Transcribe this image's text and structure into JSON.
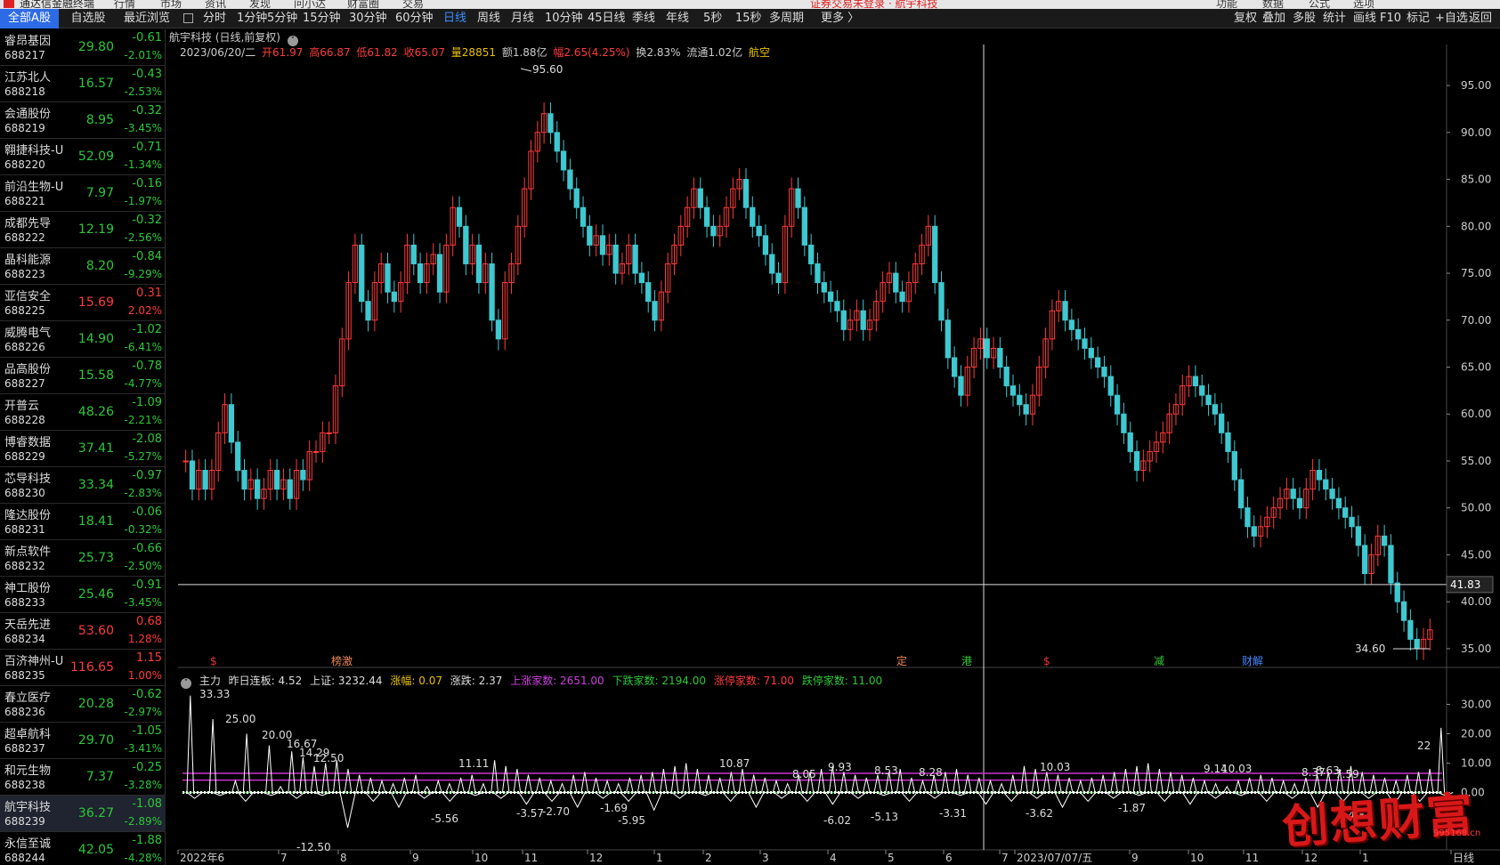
{
  "titlebar": {
    "app_title": "通达信金融终端",
    "menus": [
      "行情",
      "市场",
      "资讯",
      "发现",
      "问小达",
      "财富圈",
      "交易"
    ],
    "notice": "证券交易未登录 · 航宇科技",
    "right_menus": [
      "功能",
      "数据",
      "公式",
      "选项"
    ]
  },
  "toolbar": {
    "left_tabs": [
      "全部A股",
      "自选股",
      "最近浏览"
    ],
    "periods": [
      "分时",
      "1分钟",
      "5分钟",
      "15分钟",
      "30分钟",
      "60分钟",
      "日线",
      "周线",
      "月线",
      "10分钟",
      "45日线",
      "季线",
      "年线",
      "5秒",
      "15秒",
      "多周期",
      "更多 〉"
    ],
    "active_period": "日线",
    "right_buttons": [
      "复权",
      "叠加",
      "多股",
      "统计",
      "画线",
      "F10",
      "标记",
      "+自选",
      "返回"
    ]
  },
  "stocks": [
    {
      "name": "睿昂基因",
      "code": "688217",
      "price": "29.80",
      "change": "-0.61",
      "pct": "-2.01%",
      "dir": "dn"
    },
    {
      "name": "江苏北人",
      "code": "688218",
      "price": "16.57",
      "change": "-0.43",
      "pct": "-2.53%",
      "dir": "dn"
    },
    {
      "name": "会通股份",
      "code": "688219",
      "price": "8.95",
      "change": "-0.32",
      "pct": "-3.45%",
      "dir": "dn"
    },
    {
      "name": "翱捷科技-U",
      "code": "688220",
      "price": "52.09",
      "change": "-0.71",
      "pct": "-1.34%",
      "dir": "dn"
    },
    {
      "name": "前沿生物-U",
      "code": "688221",
      "price": "7.97",
      "change": "-0.16",
      "pct": "-1.97%",
      "dir": "dn"
    },
    {
      "name": "成都先导",
      "code": "688222",
      "price": "12.19",
      "change": "-0.32",
      "pct": "-2.56%",
      "dir": "dn"
    },
    {
      "name": "晶科能源",
      "code": "688223",
      "price": "8.20",
      "change": "-0.84",
      "pct": "-9.29%",
      "dir": "dn"
    },
    {
      "name": "亚信安全",
      "code": "688225",
      "price": "15.69",
      "change": "0.31",
      "pct": "2.02%",
      "dir": "up"
    },
    {
      "name": "威腾电气",
      "code": "688226",
      "price": "14.90",
      "change": "-1.02",
      "pct": "-6.41%",
      "dir": "dn"
    },
    {
      "name": "品高股份",
      "code": "688227",
      "price": "15.58",
      "change": "-0.78",
      "pct": "-4.77%",
      "dir": "dn"
    },
    {
      "name": "开普云",
      "code": "688228",
      "price": "48.26",
      "change": "-1.09",
      "pct": "-2.21%",
      "dir": "dn"
    },
    {
      "name": "博睿数据",
      "code": "688229",
      "price": "37.41",
      "change": "-2.08",
      "pct": "-5.27%",
      "dir": "dn"
    },
    {
      "name": "芯导科技",
      "code": "688230",
      "price": "33.34",
      "change": "-0.97",
      "pct": "-2.83%",
      "dir": "dn"
    },
    {
      "name": "隆达股份",
      "code": "688231",
      "price": "18.41",
      "change": "-0.06",
      "pct": "-0.32%",
      "dir": "dn"
    },
    {
      "name": "新点软件",
      "code": "688232",
      "price": "25.73",
      "change": "-0.66",
      "pct": "-2.50%",
      "dir": "dn"
    },
    {
      "name": "神工股份",
      "code": "688233",
      "price": "25.46",
      "change": "-0.91",
      "pct": "-3.45%",
      "dir": "dn"
    },
    {
      "name": "天岳先进",
      "code": "688234",
      "price": "53.60",
      "change": "0.68",
      "pct": "1.28%",
      "dir": "up"
    },
    {
      "name": "百济神州-U",
      "code": "688235",
      "price": "116.65",
      "change": "1.15",
      "pct": "1.00%",
      "dir": "up"
    },
    {
      "name": "春立医疗",
      "code": "688236",
      "price": "20.28",
      "change": "-0.62",
      "pct": "-2.97%",
      "dir": "dn"
    },
    {
      "name": "超卓航科",
      "code": "688237",
      "price": "29.70",
      "change": "-1.05",
      "pct": "-3.41%",
      "dir": "dn"
    },
    {
      "name": "和元生物",
      "code": "688238",
      "price": "7.37",
      "change": "-0.25",
      "pct": "-3.28%",
      "dir": "dn"
    },
    {
      "name": "航宇科技",
      "code": "688239",
      "price": "36.27",
      "change": "-1.08",
      "pct": "-2.89%",
      "dir": "dn",
      "selected": true
    },
    {
      "name": "永信至诚",
      "code": "688244",
      "price": "42.05",
      "change": "-1.88",
      "pct": "-4.28%",
      "dir": "dn"
    }
  ],
  "chart_header": {
    "title": "航宇科技 (日线,前复权)",
    "date": "2023/06/20/二",
    "open": "开61.97",
    "high": "高66.87",
    "low": "低61.82",
    "close": "收65.07",
    "volume": "量28851",
    "amount": "额1.88亿",
    "amplitude": "幅2.65(4.25%)",
    "turnover": "换2.83%",
    "float": "流通1.02亿",
    "sector": "航空"
  },
  "indicator_header": {
    "name": "主力",
    "prev_boards": "昨日连板: 4.52",
    "sh_index": "上证: 3232.44",
    "rise": "涨幅: 0.07",
    "fall": "涨跌: 2.37",
    "up_count": "上涨家数: 2651.00",
    "down_count": "下跌家数: 2194.00",
    "limit_up": "涨停家数: 71.00",
    "limit_down": "跌停家数: 11.00"
  },
  "chart_data": [
    {
      "type": "candlestick",
      "title": "航宇科技 (日线,前复权)",
      "y_ticks": [
        "95.00",
        "90.00",
        "85.00",
        "80.00",
        "75.00",
        "70.00",
        "65.00",
        "60.00",
        "55.00",
        "50.00",
        "45.00",
        "40.00",
        "35.00"
      ],
      "ylim": [
        33,
        97
      ],
      "cursor_price": "41.83",
      "high_label": "95.60",
      "low_label": "34.60",
      "x_ticks": [
        "2022年6",
        "7",
        "8",
        "9",
        "10",
        "11",
        "12",
        "1",
        "2",
        "3",
        "4",
        "5",
        "6",
        "7",
        "2023/07/07/五",
        "9",
        "10",
        "11",
        "12",
        "1",
        "日线"
      ],
      "close_path": [
        55,
        52,
        54,
        52,
        54,
        58,
        61,
        57,
        54,
        52,
        53,
        51,
        52,
        54,
        52,
        53,
        51,
        54,
        53,
        56,
        56,
        58,
        58,
        63,
        68,
        74,
        78,
        72,
        70,
        74,
        76,
        73,
        72,
        74,
        78,
        76,
        74,
        76,
        77,
        73,
        78,
        82,
        80,
        76,
        78,
        74,
        76,
        70,
        68,
        74,
        76,
        80,
        84,
        88,
        90,
        92,
        90,
        88,
        86,
        84,
        82,
        80,
        78,
        79,
        77,
        78,
        75,
        76,
        78,
        75,
        74,
        72,
        70,
        73,
        76,
        78,
        80,
        82,
        84,
        82,
        80,
        79,
        80,
        82,
        84,
        85,
        82,
        80,
        79,
        77,
        75,
        74,
        80,
        84,
        82,
        78,
        76,
        74,
        73,
        72,
        71,
        69,
        70,
        71,
        69,
        70,
        72,
        74,
        75,
        73,
        72,
        74,
        76,
        78,
        80,
        74,
        70,
        66,
        64,
        62,
        65,
        67,
        68,
        66,
        67,
        65,
        63,
        62,
        61,
        60,
        62,
        65,
        68,
        71,
        72,
        70,
        69,
        68,
        67,
        66,
        65,
        64,
        62,
        60,
        58,
        56,
        54,
        55,
        56,
        57,
        58,
        60,
        61,
        63,
        64,
        63,
        62,
        61,
        60,
        58,
        56,
        53,
        50,
        48,
        47,
        48,
        49,
        50,
        51,
        52,
        51,
        50,
        52,
        54,
        53,
        52,
        51,
        50,
        49,
        48,
        46,
        43,
        45,
        47,
        46,
        42,
        40,
        38,
        36,
        35,
        36,
        37
      ],
      "markers": [
        "$",
        "榜激",
        "定",
        "港",
        "$",
        "减",
        "财解"
      ]
    },
    {
      "type": "line",
      "title": "主力",
      "y_ticks": [
        "30.00",
        "20.00",
        "10.00",
        "0.00"
      ],
      "ylim": [
        -15,
        35
      ],
      "labels": [
        "33.33",
        "25.00",
        "20.00",
        "16.67",
        "14.29",
        "12.50",
        "11.11",
        "10.87",
        "10.03",
        "9.93",
        "9.14",
        "10.03",
        "8.63",
        "8.53",
        "8.28",
        "8.37",
        "8.05",
        "7.59",
        "-5.56",
        "-12.50",
        "-5.95",
        "-6.02",
        "-5.13",
        "-3.31",
        "-3.62",
        "-4.83",
        "-3.57",
        "-2.70",
        "-1.69",
        "-1.87",
        "22"
      ],
      "series": [
        {
          "color": "#ffffff",
          "values": [
            33,
            0,
            25,
            0,
            4,
            20,
            0,
            16,
            2,
            14,
            12,
            9,
            10,
            11,
            8,
            6,
            5,
            4,
            3,
            5,
            6,
            2,
            4,
            3,
            5,
            6,
            3,
            11,
            9,
            8,
            6,
            5,
            4,
            3,
            6,
            7,
            5,
            4,
            3,
            5,
            6,
            7,
            8,
            9,
            10,
            8,
            6,
            5,
            7,
            8,
            6,
            5,
            4,
            3,
            6,
            7,
            8,
            9,
            7,
            6,
            5,
            6,
            7,
            8,
            5,
            4,
            6,
            7,
            8,
            6,
            5,
            4,
            3,
            6,
            9,
            8,
            7,
            6,
            5,
            4,
            5,
            6,
            7,
            8,
            9,
            10,
            8,
            7,
            6,
            5,
            4,
            3,
            2,
            4,
            5,
            6,
            5,
            4,
            3,
            5,
            6,
            7,
            8,
            9,
            7,
            6,
            5,
            4,
            6,
            7,
            8,
            22
          ]
        },
        {
          "color": "#ffffff",
          "values": [
            -2,
            -1,
            -3,
            -1,
            -2,
            -1,
            -12,
            -3,
            -5,
            -2,
            -3,
            -1,
            -2,
            -4,
            -3,
            -5,
            -2,
            -3,
            -6,
            -2,
            -1,
            -3,
            -5,
            -2,
            -3,
            -4,
            -2,
            -1,
            -3,
            -2,
            -1,
            -4,
            -3,
            -2,
            -5,
            -3,
            -2,
            -1,
            -3,
            -4,
            -2,
            -1,
            -3,
            -2,
            -5,
            -3,
            -2,
            -4,
            -3,
            -1
          ]
        }
      ],
      "lines": [
        {
          "color": "#cc33cc",
          "value": 6.5
        },
        {
          "color": "#cc33cc",
          "value": 4.2
        },
        {
          "color": "#3c3",
          "value": 0
        }
      ]
    }
  ],
  "watermark": {
    "text": "创想财富",
    "url": "995168.cn"
  }
}
